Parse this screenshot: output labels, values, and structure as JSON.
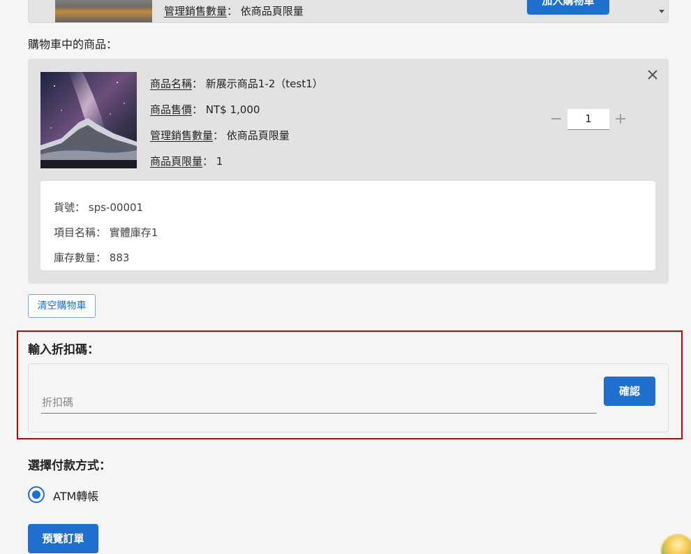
{
  "top_card": {
    "sales_label": "管理銷售數量",
    "sales_value": "依商品頁限量",
    "add_button": "加入購物車"
  },
  "cart": {
    "section_title": "購物車中的商品：",
    "item": {
      "name_label": "商品名稱",
      "name_value": "新展示商品1-2（test1）",
      "price_label": "商品售價",
      "price_value": "NT$ 1,000",
      "sales_label": "管理銷售數量",
      "sales_value": "依商品頁限量",
      "limit_label": "商品頁限量",
      "limit_value": "1",
      "quantity": "1",
      "minus": "−",
      "plus": "+"
    },
    "stock": {
      "sku_label": "貨號：",
      "sku_value": "sps-00001",
      "item_label": "項目名稱：",
      "item_value": "實體庫存1",
      "qty_label": "庫存數量：",
      "qty_value": "883"
    },
    "clear_button": "清空購物車"
  },
  "discount": {
    "title": "輸入折扣碼：",
    "placeholder": "折扣碼",
    "confirm_button": "確認"
  },
  "payment": {
    "title": "選擇付款方式：",
    "option": "ATM轉帳"
  },
  "preview_button": "預覽訂單",
  "colors": {
    "primary": "#1f6fcf",
    "highlight": "#cc0000",
    "panel": "#e2e2e2"
  }
}
